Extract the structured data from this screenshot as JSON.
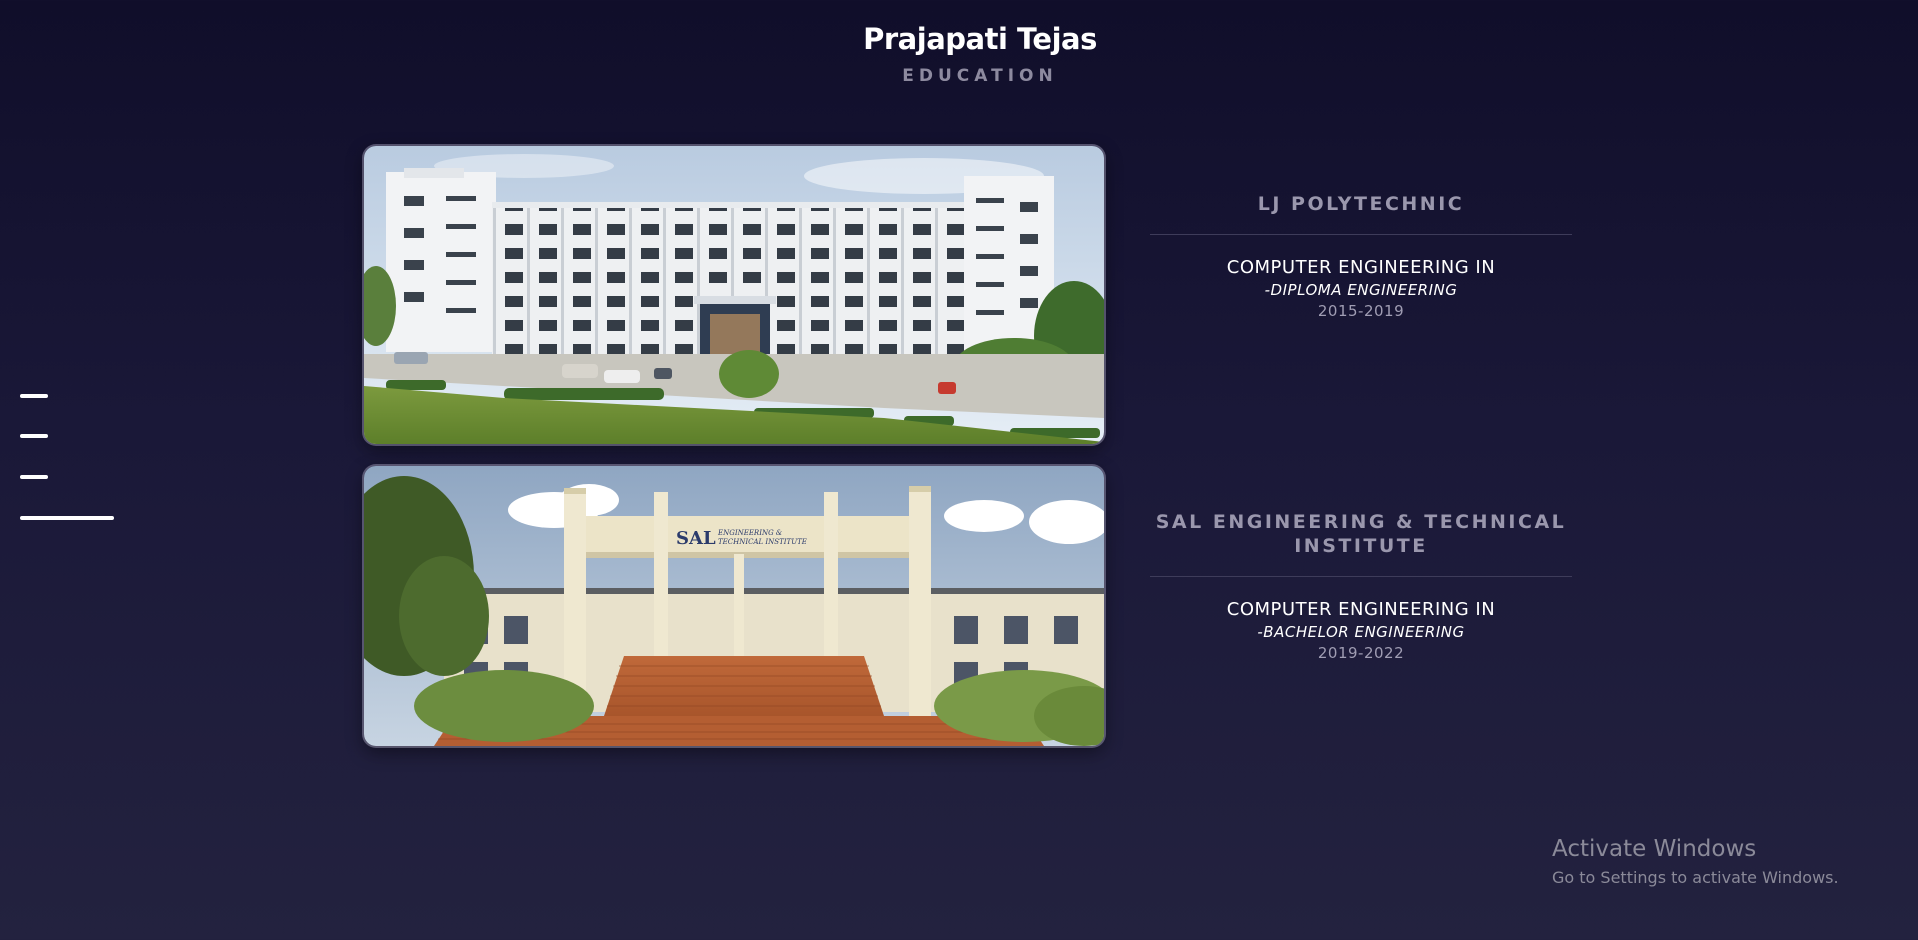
{
  "header": {
    "name": "Prajapati Tejas",
    "section": "EDUCATION"
  },
  "nav": {
    "items": [
      "menu-line-1",
      "menu-line-2",
      "menu-line-3",
      "menu-line-active"
    ]
  },
  "education": [
    {
      "institution": "LJ POLYTECHNIC",
      "degree": "COMPUTER ENGINEERING IN",
      "program": "-DIPLOMA ENGINEERING",
      "years": "2015-2019",
      "image": "college-building-photo"
    },
    {
      "institution": "SAL ENGINEERING & TECHNICAL INSTITUTE",
      "degree": "COMPUTER ENGINEERING IN",
      "program": "-BACHELOR ENGINEERING",
      "years": "2019-2022",
      "image": "institute-entrance-photo",
      "sign_text": "SAL",
      "sign_subtext_1": "ENGINEERING &",
      "sign_subtext_2": "TECHNICAL INSTITUTE"
    }
  ],
  "watermark": {
    "title": "Activate Windows",
    "subtitle": "Go to Settings to activate Windows."
  }
}
